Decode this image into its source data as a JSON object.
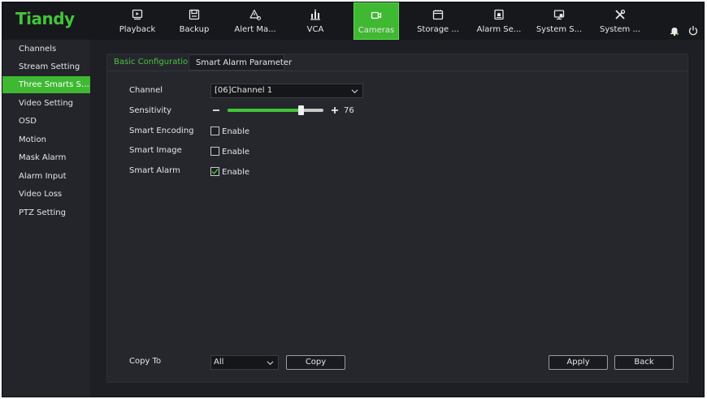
{
  "app": {
    "logo": "Tiandy"
  },
  "nav": [
    {
      "label": "Playback",
      "icon": "playback-icon"
    },
    {
      "label": "Backup",
      "icon": "backup-icon"
    },
    {
      "label": "Alert Ma...",
      "icon": "alert-icon"
    },
    {
      "label": "VCA",
      "icon": "vca-icon"
    },
    {
      "label": "Cameras",
      "icon": "camera-icon",
      "active": true
    },
    {
      "label": "Storage ...",
      "icon": "storage-icon"
    },
    {
      "label": "Alarm Se...",
      "icon": "alarm-settings-icon"
    },
    {
      "label": "System S...",
      "icon": "system-settings-icon"
    },
    {
      "label": "System ...",
      "icon": "system-tools-icon"
    }
  ],
  "topbar_icons": [
    "bell-icon",
    "power-icon"
  ],
  "sidebar": {
    "items": [
      {
        "label": "Channels"
      },
      {
        "label": "Stream Setting"
      },
      {
        "label": "Three Smarts Sett...",
        "active": true
      },
      {
        "label": "Video Setting"
      },
      {
        "label": "OSD"
      },
      {
        "label": "Motion"
      },
      {
        "label": "Mask Alarm"
      },
      {
        "label": "Alarm Input"
      },
      {
        "label": "Video Loss"
      },
      {
        "label": "PTZ Setting"
      }
    ]
  },
  "tabs": {
    "basic": "Basic Configuration",
    "smart": "Smart Alarm Parameter"
  },
  "form": {
    "channel_label": "Channel",
    "channel_value": "[06]Channel 1",
    "sensitivity_label": "Sensitivity",
    "sensitivity_value": "76",
    "sensitivity_percent": 76,
    "smart_encoding_label": "Smart Encoding",
    "smart_encoding_checked": false,
    "smart_image_label": "Smart Image",
    "smart_image_checked": false,
    "smart_alarm_label": "Smart Alarm",
    "smart_alarm_checked": true,
    "enable_label": "Enable"
  },
  "footer": {
    "copy_to_label": "Copy To",
    "copy_to_value": "All",
    "copy_label": "Copy",
    "apply_label": "Apply",
    "back_label": "Back"
  },
  "colors": {
    "accent": "#3fb832",
    "background": "#1d1f24",
    "panel": "#25272d"
  }
}
